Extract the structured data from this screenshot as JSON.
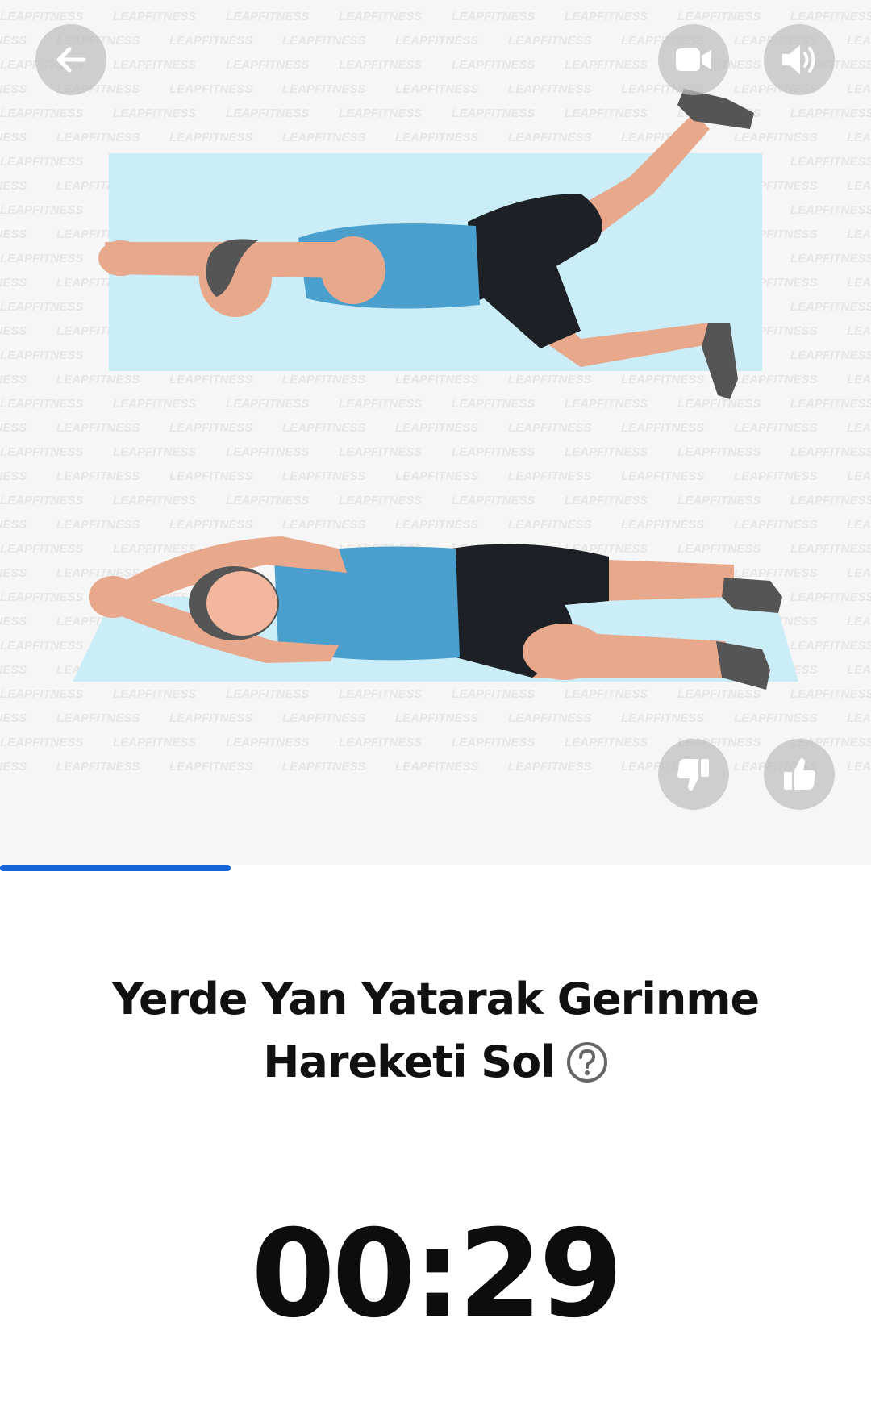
{
  "exercise": {
    "title_line1": "Yerde Yan Yatarak Gerinme",
    "title_line2": "Hareketi Sol"
  },
  "timer": {
    "value": "00:29"
  },
  "progress": {
    "fraction": 0.265,
    "color": "#1565d8"
  },
  "watermark": {
    "text": "LEAPFITNESS"
  },
  "icons": {
    "back": "arrow-left-icon",
    "video": "video-camera-icon",
    "sound": "speaker-icon",
    "dislike": "thumbs-down-icon",
    "like": "thumbs-up-icon",
    "help": "question-circle-icon"
  },
  "colors": {
    "mat": "#c8ecf8",
    "shirt": "#4a9fcd",
    "shorts": "#1d2125",
    "skin": "#e8a88c",
    "shoe": "#555555"
  }
}
